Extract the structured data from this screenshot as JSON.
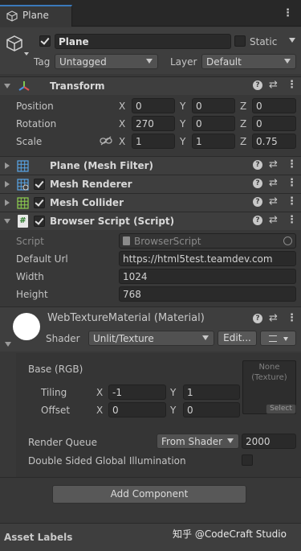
{
  "tab": {
    "title": "Plane",
    "menu_icon": "kebab-menu-icon"
  },
  "object": {
    "name": "Plane",
    "active": true,
    "static_label": "Static",
    "static_checked": false,
    "tag_label": "Tag",
    "tag_value": "Untagged",
    "layer_label": "Layer",
    "layer_value": "Default"
  },
  "transform": {
    "title": "Transform",
    "rows": [
      {
        "label": "Position",
        "x": "0",
        "y": "0",
        "z": "0"
      },
      {
        "label": "Rotation",
        "x": "270",
        "y": "0",
        "z": "0"
      },
      {
        "label": "Scale",
        "x": "1",
        "y": "1",
        "z": "0.75"
      }
    ],
    "axis": {
      "x": "X",
      "y": "Y",
      "z": "Z"
    }
  },
  "components": {
    "mesh_filter": "Plane (Mesh Filter)",
    "mesh_renderer": "Mesh Renderer",
    "mesh_collider": "Mesh Collider",
    "browser_script": "Browser Script (Script)"
  },
  "browser_script": {
    "script_label": "Script",
    "script_value": "BrowserScript",
    "url_label": "Default Url",
    "url_value": "https://html5test.teamdev.com",
    "width_label": "Width",
    "width_value": "1024",
    "height_label": "Height",
    "height_value": "768"
  },
  "material": {
    "name": "WebTextureMaterial (Material)",
    "shader_label": "Shader",
    "shader_value": "Unlit/Texture",
    "edit_label": "Edit...",
    "base_label": "Base (RGB)",
    "texture_none": "None",
    "texture_type": "(Texture)",
    "texture_select": "Select",
    "tiling_label": "Tiling",
    "tiling_x": "-1",
    "tiling_y": "1",
    "offset_label": "Offset",
    "offset_x": "0",
    "offset_y": "0",
    "axis_x": "X",
    "axis_y": "Y",
    "render_queue_label": "Render Queue",
    "render_queue_mode": "From Shader",
    "render_queue_value": "2000",
    "dsgi_label": "Double Sided Global Illumination"
  },
  "add_component_label": "Add Component",
  "asset_labels": "Asset Labels",
  "watermark": "知乎 @CodeCraft Studio"
}
